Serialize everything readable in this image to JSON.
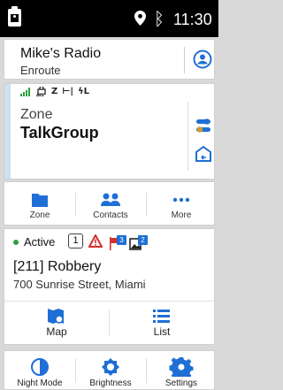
{
  "status_bar": {
    "time": "11:30",
    "icons": [
      "clipboard-icon",
      "location-pin-icon",
      "bluetooth-icon"
    ]
  },
  "radio": {
    "name": "Mike's Radio",
    "status": "Enroute",
    "icon": "user-circle-icon"
  },
  "zone_card": {
    "indicator_icons": [
      "signal-bars-icon",
      "aes-encryption-icon",
      "scan-icon",
      "talkaround-icon",
      "low-power-icon"
    ],
    "indicator_labels": [
      "AES"
    ],
    "zone_label": "Zone",
    "talkgroup": "TalkGroup",
    "accent_color": "#cfe0ee"
  },
  "nav_top": {
    "items": [
      {
        "label": "Zone",
        "icon": "folder-icon"
      },
      {
        "label": "Contacts",
        "icon": "contacts-icon"
      },
      {
        "label": "More",
        "icon": "more-dots-icon"
      }
    ]
  },
  "incident": {
    "status": "Active",
    "status_color": "#2e9d3e",
    "count": "1",
    "flag_badge": "3",
    "image_badge": "2",
    "title": "[211] Robbery",
    "address": "700 Sunrise Street, Miami",
    "actions": [
      {
        "label": "Map",
        "icon": "map-icon"
      },
      {
        "label": "List",
        "icon": "list-icon"
      }
    ]
  },
  "nav_bottom": {
    "items": [
      {
        "label": "Night Mode",
        "icon": "night-mode-icon"
      },
      {
        "label": "Brightness",
        "icon": "brightness-icon"
      },
      {
        "label": "Settings",
        "icon": "settings-gear-icon"
      }
    ]
  },
  "colors": {
    "accent_blue": "#1f6fd6",
    "alert_red": "#d62f2f"
  }
}
